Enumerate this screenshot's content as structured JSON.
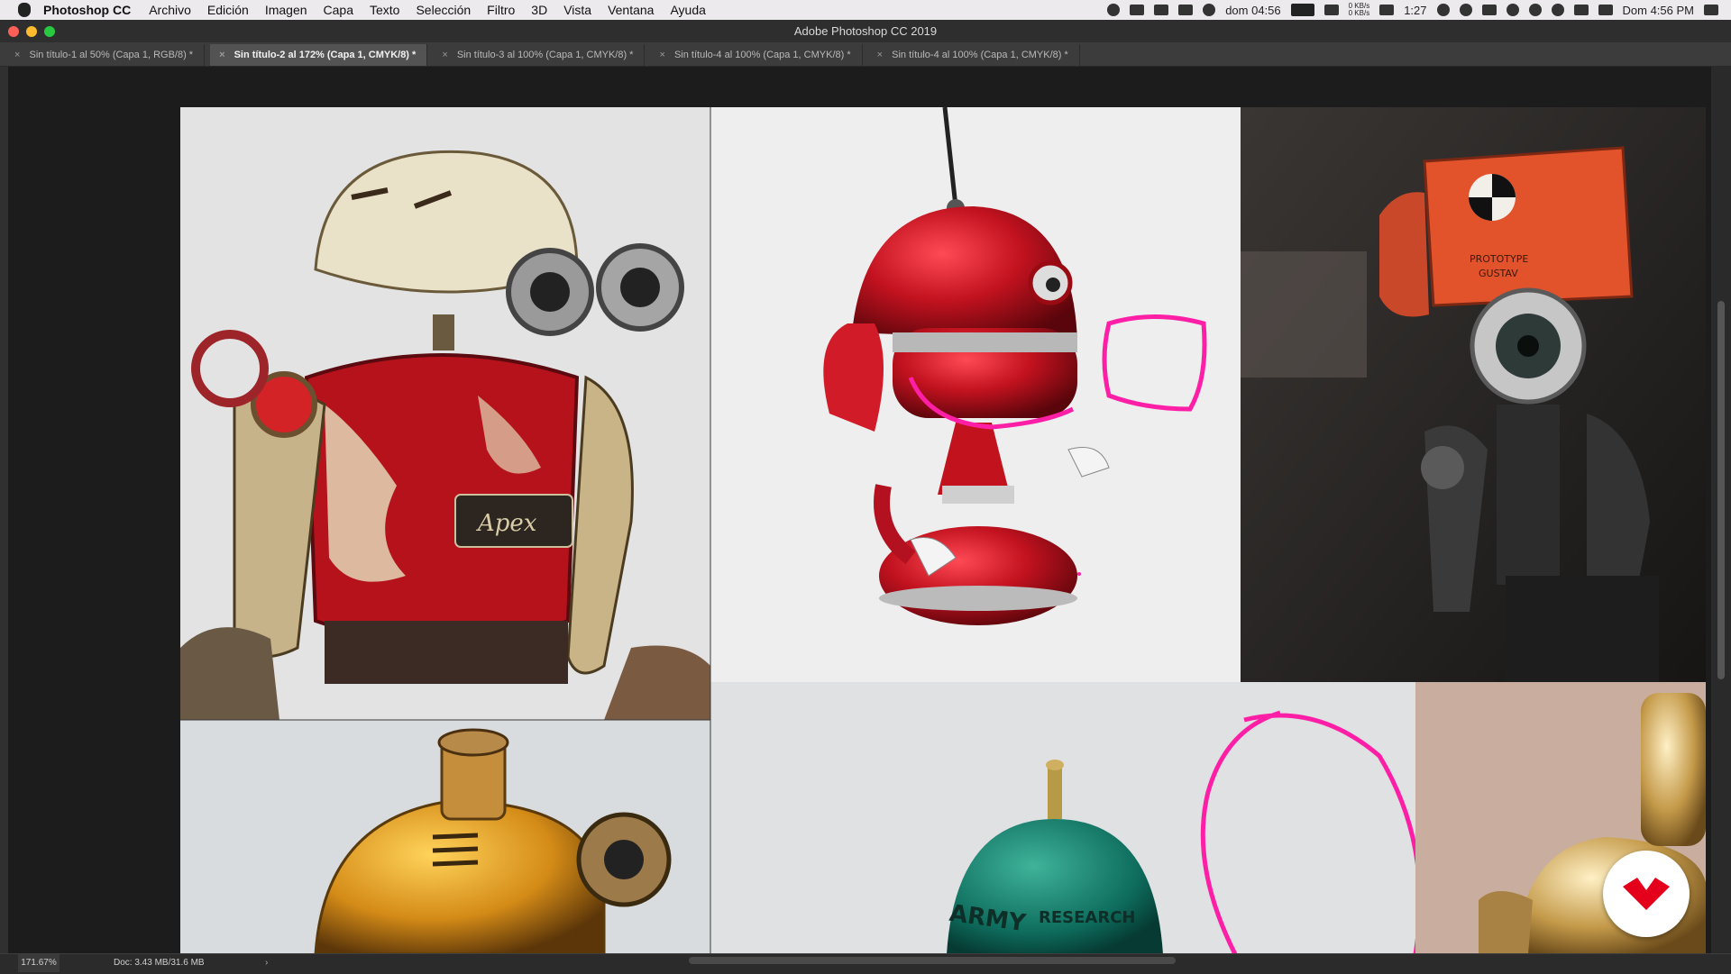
{
  "menubar": {
    "app_name": "Photoshop CC",
    "items": [
      "Archivo",
      "Edición",
      "Imagen",
      "Capa",
      "Texto",
      "Selección",
      "Filtro",
      "3D",
      "Vista",
      "Ventana",
      "Ayuda"
    ],
    "tray": {
      "clock_left": "dom 04:56",
      "net_up": "0 KB/s",
      "net_down": "0 KB/s",
      "battery_time": "1:27",
      "datetime": "Dom 4:56 PM"
    }
  },
  "window": {
    "title": "Adobe Photoshop CC 2019"
  },
  "tabs": [
    {
      "label": "Sin título-1 al 50% (Capa 1, RGB/8) *",
      "active": false
    },
    {
      "label": "Sin título-2 al 172% (Capa 1, CMYK/8) *",
      "active": true
    },
    {
      "label": "Sin título-3 al 100% (Capa 1, CMYK/8) *",
      "active": false
    },
    {
      "label": "Sin título-4 al 100% (Capa 1, CMYK/8) *",
      "active": false
    },
    {
      "label": "Sin título-4 al 100% (Capa 1, CMYK/8) *",
      "active": false
    }
  ],
  "canvas": {
    "images": [
      "photo-red-robot-rusty",
      "photo-red-robot-glossy",
      "photo-orange-robot-prototype-gustav",
      "photo-yellow-robot",
      "photo-green-robot-army-research",
      "photo-gold-robot"
    ],
    "photo_text": {
      "gustav_plate": [
        "PROTOTYPE",
        "GUSTAV"
      ],
      "green_robot": [
        "ARMY",
        "RESEARCH"
      ],
      "apex_plate": "Apex"
    },
    "annotation_color": "#ff1fa6"
  },
  "statusbar": {
    "zoom": "171.67%",
    "doc_info": "Doc: 3.43 MB/31.6 MB",
    "arrow": "›"
  },
  "brand_color": "#e4001b"
}
